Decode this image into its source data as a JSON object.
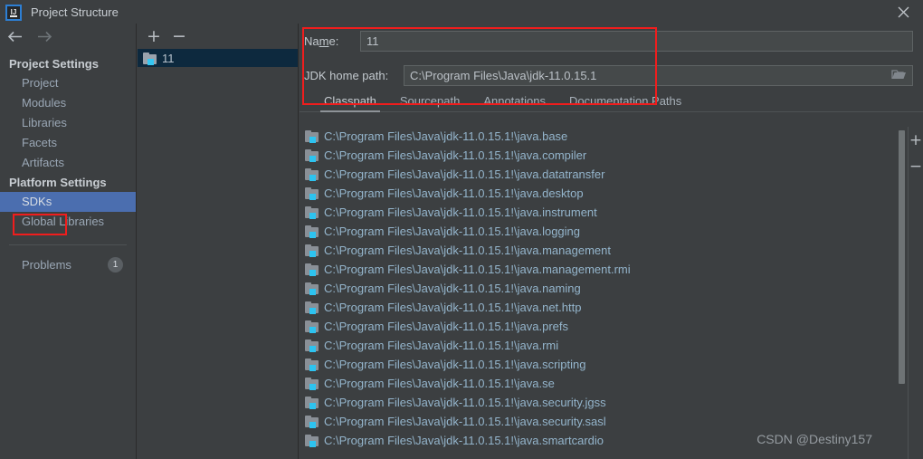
{
  "window": {
    "title": "Project Structure",
    "app_icon": "intellij-idea-logo-icon",
    "close_icon": "close-icon"
  },
  "nav": {
    "back_icon": "arrow-left-icon",
    "forward_icon": "arrow-right-icon"
  },
  "sidebar": {
    "groups": [
      {
        "label": "Project Settings",
        "items": [
          {
            "label": "Project",
            "selected": false
          },
          {
            "label": "Modules",
            "selected": false
          },
          {
            "label": "Libraries",
            "selected": false
          },
          {
            "label": "Facets",
            "selected": false
          },
          {
            "label": "Artifacts",
            "selected": false
          }
        ]
      },
      {
        "label": "Platform Settings",
        "items": [
          {
            "label": "SDKs",
            "selected": true
          },
          {
            "label": "Global Libraries",
            "selected": false
          }
        ]
      }
    ],
    "problems": {
      "label": "Problems",
      "count": "1"
    },
    "highlight_color": "#f01d1d",
    "selection_color": "#4b6eaf"
  },
  "sdk_list": {
    "add_label": "+",
    "remove_label": "−",
    "items": [
      {
        "label": "11",
        "icon": "jdk-folder-icon",
        "selected": true
      }
    ]
  },
  "details": {
    "name_label_pre": "Na",
    "name_label_mnemonic": "m",
    "name_label_post": "e:",
    "name_value": "11",
    "jdk_home_label": "JDK home path:",
    "jdk_home_value": "C:\\Program Files\\Java\\jdk-11.0.15.1",
    "browse_icon": "folder-browse-icon",
    "highlight_color": "#f01d1d"
  },
  "tabs": [
    {
      "label": "Classpath",
      "active": true
    },
    {
      "label": "Sourcepath",
      "active": false
    },
    {
      "label": "Annotations",
      "active": false
    },
    {
      "label": "Documentation Paths",
      "active": false
    }
  ],
  "classpath": {
    "add_label": "+",
    "remove_label": "−",
    "entries": [
      "C:\\Program Files\\Java\\jdk-11.0.15.1!\\java.base",
      "C:\\Program Files\\Java\\jdk-11.0.15.1!\\java.compiler",
      "C:\\Program Files\\Java\\jdk-11.0.15.1!\\java.datatransfer",
      "C:\\Program Files\\Java\\jdk-11.0.15.1!\\java.desktop",
      "C:\\Program Files\\Java\\jdk-11.0.15.1!\\java.instrument",
      "C:\\Program Files\\Java\\jdk-11.0.15.1!\\java.logging",
      "C:\\Program Files\\Java\\jdk-11.0.15.1!\\java.management",
      "C:\\Program Files\\Java\\jdk-11.0.15.1!\\java.management.rmi",
      "C:\\Program Files\\Java\\jdk-11.0.15.1!\\java.naming",
      "C:\\Program Files\\Java\\jdk-11.0.15.1!\\java.net.http",
      "C:\\Program Files\\Java\\jdk-11.0.15.1!\\java.prefs",
      "C:\\Program Files\\Java\\jdk-11.0.15.1!\\java.rmi",
      "C:\\Program Files\\Java\\jdk-11.0.15.1!\\java.scripting",
      "C:\\Program Files\\Java\\jdk-11.0.15.1!\\java.se",
      "C:\\Program Files\\Java\\jdk-11.0.15.1!\\java.security.jgss",
      "C:\\Program Files\\Java\\jdk-11.0.15.1!\\java.security.sasl",
      "C:\\Program Files\\Java\\jdk-11.0.15.1!\\java.smartcardio"
    ]
  },
  "watermark": "CSDN @Destiny157"
}
